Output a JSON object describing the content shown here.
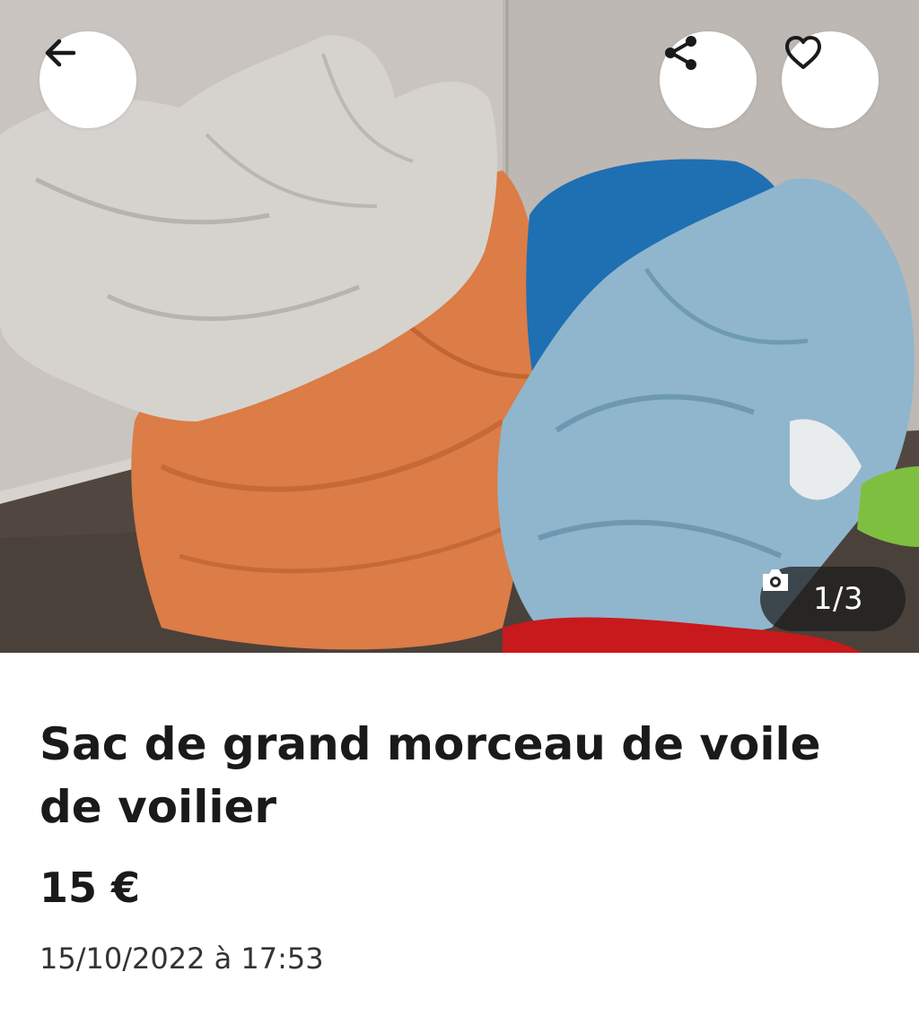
{
  "listing": {
    "title": "Sac de grand morceau de voile de voilier",
    "price": "15 €",
    "date": "15/10/2022 à 17:53"
  },
  "gallery": {
    "counter": "1/3"
  },
  "icons": {
    "back": "arrow-left-icon",
    "share": "share-icon",
    "favorite": "heart-icon",
    "camera": "camera-icon"
  },
  "colors": {
    "text": "#1a1a1a",
    "button_bg": "#ffffff",
    "counter_bg": "#1c1c1c"
  }
}
